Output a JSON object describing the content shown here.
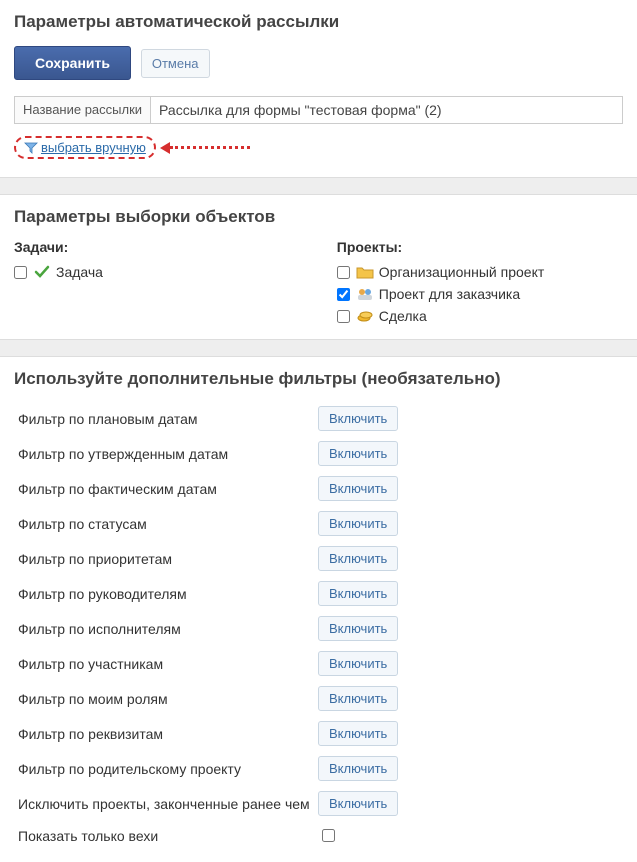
{
  "header": {
    "title": "Параметры автоматической рассылки",
    "save_label": "Сохранить",
    "cancel_label": "Отмена",
    "name_field_label": "Название рассылки",
    "name_field_value": "Рассылка для формы \"тестовая форма\" (2)",
    "manual_select_label": "выбрать вручную"
  },
  "selection": {
    "title": "Параметры выборки объектов",
    "tasks_heading": "Задачи:",
    "projects_heading": "Проекты:",
    "tasks": [
      {
        "label": "Задача",
        "checked": false,
        "icon": "check-green"
      }
    ],
    "projects": [
      {
        "label": "Организационный проект",
        "checked": false,
        "icon": "folder-yellow"
      },
      {
        "label": "Проект для заказчика",
        "checked": true,
        "icon": "people"
      },
      {
        "label": "Сделка",
        "checked": false,
        "icon": "coins"
      }
    ]
  },
  "filters": {
    "title": "Используйте дополнительные фильтры (необязательно)",
    "enable_label": "Включить",
    "items": [
      "Фильтр по плановым датам",
      "Фильтр по утвержденным датам",
      "Фильтр по фактическим датам",
      "Фильтр по статусам",
      "Фильтр по приоритетам",
      "Фильтр по руководителям",
      "Фильтр по исполнителям",
      "Фильтр по участникам",
      "Фильтр по моим ролям",
      "Фильтр по реквизитам",
      "Фильтр по родительскому проекту",
      "Исключить проекты, законченные ранее чем"
    ],
    "milestones_only_label": "Показать только вехи",
    "milestones_only_checked": false
  }
}
